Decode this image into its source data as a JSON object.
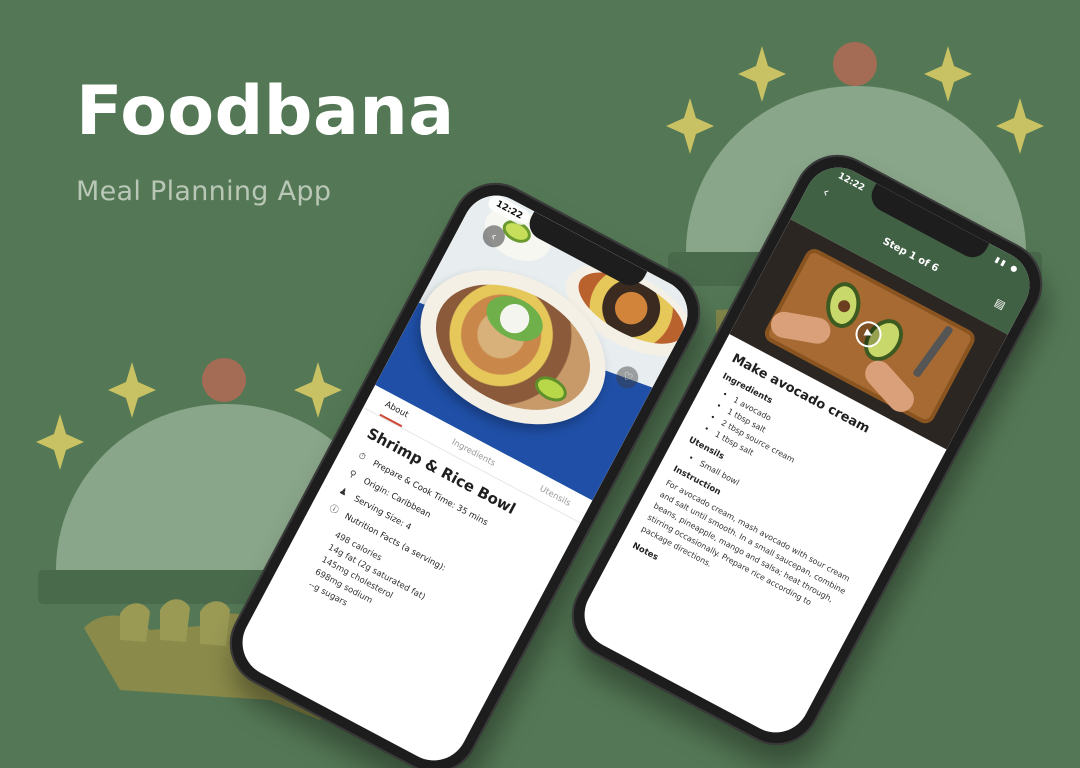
{
  "brand": {
    "title": "Foodbana",
    "subtitle": "Meal Planning App"
  },
  "colors": {
    "background": "#547855",
    "header_green": "#416144",
    "accent_red": "#d04a3a",
    "sparkle_yellow": "#c9c264"
  },
  "decorations": {
    "icons": [
      "sparkle-icon",
      "cloche-icon",
      "serving-hand-icon"
    ]
  },
  "left_phone": {
    "status_time": "12:22",
    "back_icon": "chevron-left-icon",
    "favorite_icon": "heart-icon",
    "tabs": [
      {
        "label": "About",
        "active": true
      },
      {
        "label": "Ingredients",
        "active": false
      },
      {
        "label": "Utensils",
        "active": false
      }
    ],
    "recipe_title": "Shrimp & Rice Bowl",
    "info": [
      {
        "icon": "timer-icon",
        "text": "Prepare & Cook Time: 35 mins"
      },
      {
        "icon": "location-pin-icon",
        "text": "Origin: Caribbean"
      },
      {
        "icon": "people-icon",
        "text": "Serving Size: 4"
      },
      {
        "icon": "info-icon",
        "text": "Nutrition Facts (a serving):"
      }
    ],
    "nutrition_facts": [
      "498 calories",
      "14g fat (2g saturated fat)",
      "145mg cholesterol",
      "698mg sodium",
      "--g sugars"
    ]
  },
  "right_phone": {
    "status_time": "12:22",
    "back_icon": "arrow-left-icon",
    "step_title": "Step 1 of 6",
    "document_icon": "document-icon",
    "play_icon": "play-icon",
    "step_name": "Make avocado cream",
    "ingredients_title": "Ingredients",
    "ingredients": [
      "1 avocado",
      "1 tbsp salt",
      "2 tbsp source cream",
      "1 tbsp salt"
    ],
    "utensils_title": "Utensils",
    "utensils": [
      "Small bowl"
    ],
    "instruction_title": "Instruction",
    "instruction": "For avocado cream, mash avocado with sour cream and salt until smooth. In a small saucepan, combine beans, pineapple, mango and salsa; heat through, stirring occasionally. Prepare rice according to package directions.",
    "notes_title": "Notes"
  }
}
